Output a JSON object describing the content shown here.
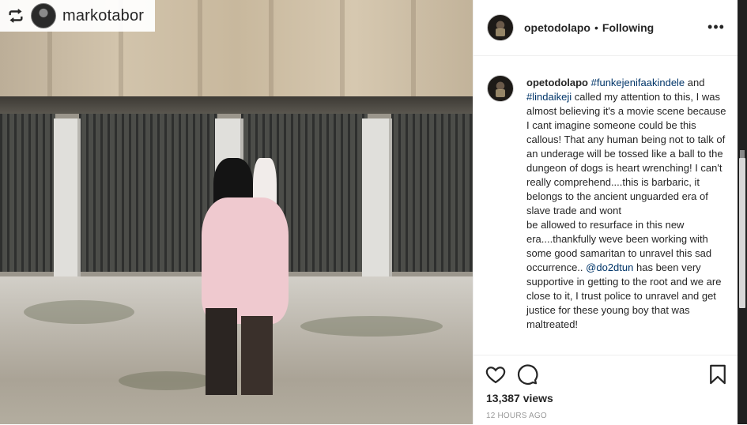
{
  "repost": {
    "username": "markotabor",
    "icon": "repost-icon"
  },
  "post": {
    "author": "opetodolapo",
    "separator": "•",
    "follow_status": "Following",
    "more_icon": "ellipsis-icon",
    "more_label": "•••"
  },
  "caption": {
    "username": "opetodolapo",
    "tag1": "#funkejenifaakindele",
    "and": "and",
    "tag2": "#lindaikeji",
    "text1": "called my attention to this, I was almost believing it's a movie scene because I cant imagine someone could be this callous! That any human being not to talk of an underage will be tossed like a ball to the dungeon of dogs is heart wrenching! I can't really comprehend....this is barbaric, it belongs to the ancient unguarded era of slave trade and wont",
    "text2": "be allowed to resurface in this new era....thankfully weve been working with some good samaritan to unravel this sad occurrence..",
    "mention": "@do2dtun",
    "text3": "has been very supportive in getting to the root and we are close to it, I trust police to unravel and get justice for these young boy that was maltreated!"
  },
  "actions": {
    "like_icon": "heart-icon",
    "comment_icon": "comment-icon",
    "save_icon": "bookmark-icon",
    "views": "13,387 views",
    "timestamp": "12 HOURS AGO"
  },
  "colors": {
    "link": "#003569",
    "muted": "#999999",
    "text": "#262626",
    "border": "#efefef"
  }
}
